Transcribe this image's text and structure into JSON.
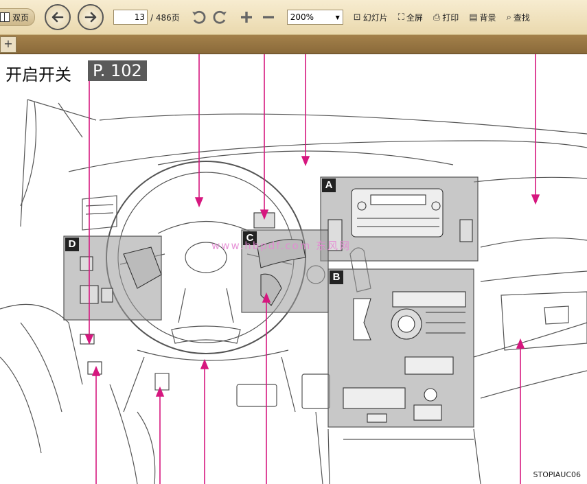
{
  "toolbar": {
    "dual_page_label": "双页",
    "current_page": "13",
    "total_pages": "/ 486页",
    "zoom_value": "200%",
    "slideshow_label": "幻灯片",
    "fullscreen_label": "全屏",
    "print_label": "打印",
    "background_label": "背景",
    "find_label": "查找"
  },
  "tabs": {
    "new_tab_label": "+"
  },
  "content": {
    "heading": "开启开关",
    "page_ref": "P. 102",
    "watermark": "www.hbpdf.com 东风网",
    "figure_code": "STOPIAUC06",
    "labels": [
      "A",
      "B",
      "C",
      "D"
    ]
  },
  "colors": {
    "leader": "#d6177f",
    "callout_box": "#8f8f8f",
    "toolbar": "#efe2c0"
  }
}
